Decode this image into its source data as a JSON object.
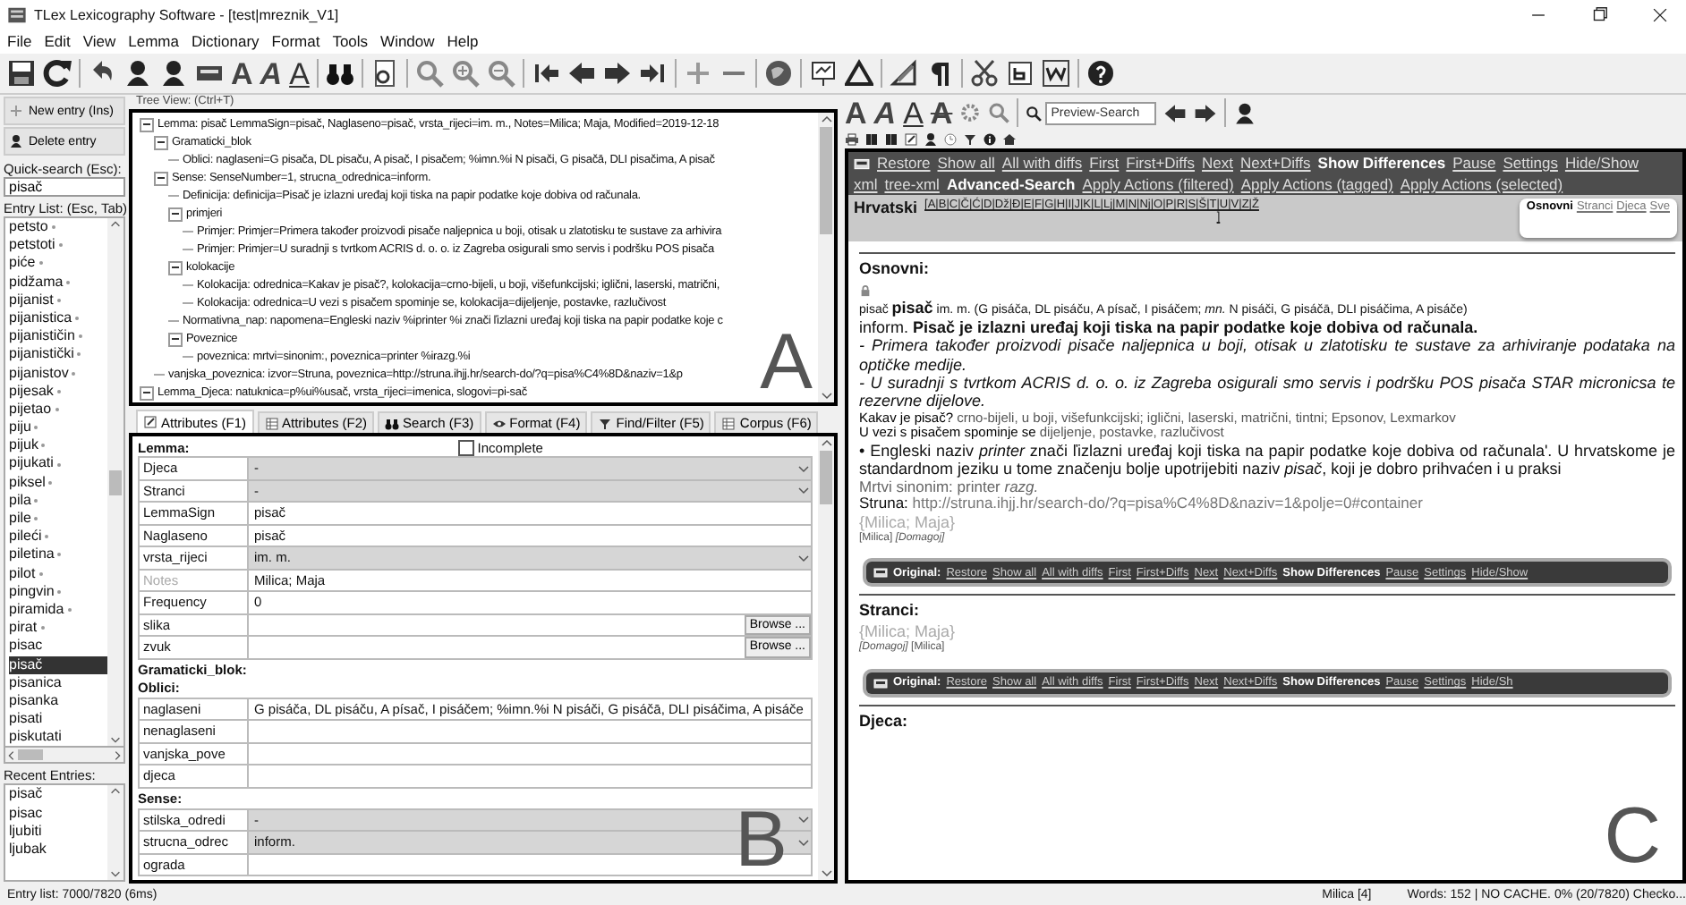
{
  "window": {
    "title": "TLex Lexicography Software - [test|mreznik_V1]"
  },
  "menu": [
    "File",
    "Edit",
    "View",
    "Lemma",
    "Dictionary",
    "Format",
    "Tools",
    "Window",
    "Help"
  ],
  "toolbar": {
    "font_styles": [
      {
        "label": "A"
      },
      {
        "label": "A"
      },
      {
        "label": "A"
      }
    ]
  },
  "sidebar": {
    "buttons": [
      "New entry (Ins)",
      "Delete entry"
    ],
    "quick_search_label": "Quick-search (Esc):",
    "quick_search_value": "pisač",
    "entry_list_label": "Entry List: (Esc, Tab)",
    "entries": [
      {
        "text": "petsto",
        "marked": true,
        "selected": false
      },
      {
        "text": "petstoti",
        "marked": true,
        "selected": false
      },
      {
        "text": "piće",
        "marked": true,
        "selected": false
      },
      {
        "text": "pidžama",
        "marked": true,
        "selected": false
      },
      {
        "text": "pijanist",
        "marked": true,
        "selected": false
      },
      {
        "text": "pijanistica",
        "marked": true,
        "selected": false
      },
      {
        "text": "pijanističin",
        "marked": true,
        "selected": false
      },
      {
        "text": "pijanistički",
        "marked": true,
        "selected": false
      },
      {
        "text": "pijanistov",
        "marked": true,
        "selected": false
      },
      {
        "text": "pijesak",
        "marked": true,
        "selected": false
      },
      {
        "text": "pijetao",
        "marked": true,
        "selected": false
      },
      {
        "text": "piju",
        "marked": true,
        "selected": false
      },
      {
        "text": "pijuk",
        "marked": true,
        "selected": false
      },
      {
        "text": "pijukati",
        "marked": true,
        "selected": false
      },
      {
        "text": "piksel",
        "marked": true,
        "selected": false
      },
      {
        "text": "pila",
        "marked": true,
        "selected": false
      },
      {
        "text": "pile",
        "marked": true,
        "selected": false
      },
      {
        "text": "pileći",
        "marked": true,
        "selected": false
      },
      {
        "text": "piletina",
        "marked": true,
        "selected": false
      },
      {
        "text": "pilot",
        "marked": true,
        "selected": false
      },
      {
        "text": "pingvin",
        "marked": true,
        "selected": false
      },
      {
        "text": "piramida",
        "marked": true,
        "selected": false
      },
      {
        "text": "pirat",
        "marked": true,
        "selected": false
      },
      {
        "text": "pisac",
        "marked": false,
        "selected": false
      },
      {
        "text": "pisač",
        "marked": false,
        "selected": true
      },
      {
        "text": "pisanica",
        "marked": false,
        "selected": false
      },
      {
        "text": "pisanka",
        "marked": false,
        "selected": false
      },
      {
        "text": "pisati",
        "marked": false,
        "selected": false
      },
      {
        "text": "piskutati",
        "marked": false,
        "selected": false
      }
    ],
    "recent_label": "Recent Entries:",
    "recent": [
      "pisač",
      "pisac",
      "ljubiti",
      "ljubak"
    ]
  },
  "tree": {
    "title": "Tree View: (Ctrl+T)",
    "nodes": [
      {
        "text": "Lemma: pisač  LemmaSign=pisač, Naglaseno=pisač, vrsta_rijeci=im. m., Notes=Milica; Maja, Modified=2019-12-18",
        "expanded": true,
        "children": [
          {
            "text": "Gramaticki_blok",
            "expanded": true,
            "children": [
              {
                "text": "Oblici:  naglaseni=G pisača, DL pisaču, A pisač, I pisačem; %imn.%i N pisači, G pisačā, DLI pisačima, A pisač"
              }
            ]
          },
          {
            "text": "Sense:  SenseNumber=1, strucna_odrednica=inform.",
            "expanded": true,
            "children": [
              {
                "text": "Definicija:  definicija=Pisač je izlazni uređaj koji tiska na papir podatke koje dobiva od računala."
              },
              {
                "text": "primjeri",
                "expanded": true,
                "children": [
                  {
                    "text": "Primjer:  Primjer=Primera također proizvodi pisače naljepnica u boji, otisak u zlatotisku te sustave za arhivira"
                  },
                  {
                    "text": "Primjer:  Primjer=U suradnji s tvrtkom ACRIS d. o. o. iz Zagreba osigurali smo servis i podršku POS pisača"
                  }
                ]
              },
              {
                "text": "kolokacije",
                "expanded": true,
                "children": [
                  {
                    "text": "Kolokacija:  odrednica=Kakav je pisač?, kolokacija=crno-bijeli, u boji, višefunkcijski; iglični, laserski, matrični,"
                  },
                  {
                    "text": "Kolokacija:  odrednica=U vezi s pisačem spominje se, kolokacija=dijeljenje, postavke, razlučivost"
                  }
                ]
              },
              {
                "text": "Normativna_nap:  napomena=Engleski naziv %iprinter %i znači ľizlazni uređaj koji tiska na papir podatke koje c"
              },
              {
                "text": "Poveznice",
                "expanded": true,
                "children": [
                  {
                    "text": "poveznica:  mrtvi=sinonim:, poveznica=printer %irazg.%i"
                  }
                ]
              }
            ]
          },
          {
            "text": "vanjska_poveznica:  izvor=Struna, poveznica=http://struna.ihjj.hr/search-do/?q=pisa%C4%8D&naziv=1&p"
          }
        ]
      },
      {
        "text": "Lemma_Djeca:  natuknica=p%ui%usač, vrsta_rijeci=imenica, slogovi=pi-sač",
        "expanded": true
      }
    ]
  },
  "tabs": [
    {
      "label": "Attributes (F1)",
      "selected": true
    },
    {
      "label": "Attributes (F2)",
      "selected": false
    },
    {
      "label": "Search (F3)",
      "selected": false
    },
    {
      "label": "Format (F4)",
      "selected": false
    },
    {
      "label": "Find/Filter (F5)",
      "selected": false
    },
    {
      "label": "Corpus (F6)",
      "selected": false
    }
  ],
  "form": {
    "sections": [
      {
        "heading": "Lemma:",
        "checkbox": {
          "label": "Incomplete",
          "checked": false
        },
        "rows": [
          {
            "label": "Djeca",
            "kind": "dropdown",
            "value": "-",
            "disabled": false
          },
          {
            "label": "Stranci",
            "kind": "dropdown",
            "value": "-",
            "disabled": false
          },
          {
            "label": "LemmaSign",
            "kind": "text",
            "value": "pisač",
            "disabled": false
          },
          {
            "label": "Naglaseno",
            "kind": "text",
            "value": "pisač",
            "disabled": false
          },
          {
            "label": "vrsta_rijeci",
            "kind": "dropdown",
            "value": "im. m.",
            "disabled": false
          },
          {
            "label": "Notes",
            "kind": "text",
            "value": "Milica; Maja",
            "disabled": true
          },
          {
            "label": "Frequency",
            "kind": "text",
            "value": "0",
            "disabled": false
          },
          {
            "label": "slika",
            "kind": "browse",
            "button": "Browse ...",
            "disabled": false
          },
          {
            "label": "zvuk",
            "kind": "browse",
            "button": "Browse ...",
            "disabled": false
          }
        ]
      },
      {
        "heading": "Gramaticki_blok:"
      },
      {
        "heading": "Oblici:",
        "rows": [
          {
            "label": "naglaseni",
            "kind": "text",
            "value": "G pisáča, DL pisáču, A písač, I pisáčem; %imn.%i N pisáči, G pisáčā, DLI pisáčima, A pisáče",
            "disabled": false
          },
          {
            "label": "nenaglaseni",
            "kind": "text",
            "disabled": false
          },
          {
            "label": "vanjska_pove",
            "kind": "text",
            "disabled": false
          },
          {
            "label": "djeca",
            "kind": "text",
            "disabled": false
          }
        ]
      },
      {
        "heading": "Sense:",
        "rows": [
          {
            "label": "stilska_odredi",
            "kind": "dropdown",
            "value": "-",
            "disabled": false
          },
          {
            "label": "strucna_odrec",
            "kind": "dropdown",
            "value": "inform.",
            "disabled": false
          },
          {
            "label": "ograda",
            "kind": "text",
            "disabled": false
          }
        ]
      }
    ]
  },
  "preview_toolbar": {
    "font_styles": [
      {
        "label": "A"
      },
      {
        "label": "A"
      },
      {
        "label": "A"
      },
      {
        "label": "A"
      }
    ],
    "search_placeholder": "Preview-Search"
  },
  "preview": {
    "action_links": [
      {
        "text": "Restore",
        "strong": false
      },
      {
        "text": "Show all",
        "strong": false
      },
      {
        "text": "All with diffs",
        "strong": false
      },
      {
        "text": "First",
        "strong": false
      },
      {
        "text": "First+Diffs",
        "strong": false
      },
      {
        "text": "Next",
        "strong": false
      },
      {
        "text": "Next+Diffs",
        "strong": false
      },
      {
        "text": "Show Differences",
        "strong": true
      },
      {
        "text": "Pause",
        "strong": false
      },
      {
        "text": "Settings",
        "strong": false
      },
      {
        "text": "Hide/Show",
        "strong": false
      }
    ],
    "view_links": [
      {
        "text": "xml",
        "strong": false
      },
      {
        "text": "tree-xml",
        "strong": false
      },
      {
        "text": "Advanced-Search",
        "strong": true
      },
      {
        "text": "Apply Actions (filtered)",
        "strong": false
      },
      {
        "text": "Apply Actions (tagged)",
        "strong": false
      },
      {
        "text": "Apply Actions (selected)",
        "strong": false
      }
    ],
    "language": "Hrvatski",
    "alphabet": "[A|B|C|Č|Ć|D|Dž|Đ|E|F|G|H|I|J|K|L|Lj|M|N|Nj|O|P|R|S|Š|T|U|V|Z|Ž",
    "alphabet_end": "]",
    "view_tabs": [
      {
        "label": "Osnovni",
        "selected": true
      },
      {
        "label": "Stranci",
        "selected": false
      },
      {
        "label": "Djeca",
        "selected": false
      },
      {
        "label": "Sve",
        "selected": false
      }
    ],
    "sections": [
      {
        "heading": "Osnovni:",
        "lines": [
          {
            "kind": "headword",
            "text": "pisač **pisač** im. m. (G pisáča, DL pisáču, A písač, I pisáčem; *mn.* N pisáči, G pisáčā, DLI pisáčima, A pisáče)"
          },
          {
            "kind": "definition",
            "text": "inform. **Pisač je izlazni uređaj koji tiska na papir podatke koje dobiva od računala.**"
          },
          {
            "kind": "example",
            "text": "- Primera također proizvodi pisače naljepnica u boji, otisak u zlatotisku te sustave za arhiviranje podataka na optičke medije."
          },
          {
            "kind": "example",
            "text": "- U suradnji s tvrtkom ACRIS d. o. o. iz Zagreba osigurali smo servis i podršku POS pisača STAR micronicsa te rezervne dijelove."
          },
          {
            "kind": "collocation",
            "head": "Kakav je pisač?",
            "text": "crno-bijeli, u boji, višefunkcijski; iglični, laserski, matrični,  tintni; Epsonov, Lexmarkov"
          },
          {
            "kind": "collocation",
            "head": "U vezi s pisačem spominje se",
            "text": "dijeljenje, postavke, razlučivost"
          },
          {
            "kind": "note",
            "text": "• Engleski naziv *printer* znači ľizlazni uređaj koji tiska na papir podatke koje dobiva od računala'. U hrvatskome je standardnom jeziku u tome značenju bolje upotrijebiti naziv *pisač*, koji je dobro prihvaćen i u praksi"
          },
          {
            "kind": "synonym",
            "text": "Mrtvi sinonim: printer *razg.*"
          },
          {
            "kind": "source",
            "head": "Struna:",
            "text": "http://struna.ihjj.hr/search-do/?q=pisa%C4%8D&naziv=1&polje=0#container"
          },
          {
            "kind": "authors",
            "text": "{Milica; Maja}"
          },
          {
            "kind": "editors",
            "text": "[Milica] *[Domagoj]*"
          }
        ],
        "original_bar": {
          "label": "Original:",
          "links": [
            {
              "text": "Restore",
              "strong": false
            },
            {
              "text": "Show all",
              "strong": false
            },
            {
              "text": "All with diffs",
              "strong": false
            },
            {
              "text": "First",
              "strong": false
            },
            {
              "text": "First+Diffs",
              "strong": false
            },
            {
              "text": "Next",
              "strong": false
            },
            {
              "text": "Next+Diffs",
              "strong": false
            },
            {
              "text": "Show Differences",
              "strong": true
            },
            {
              "text": "Pause",
              "strong": false
            },
            {
              "text": "Settings",
              "strong": false
            },
            {
              "text": "Hide/Show",
              "strong": false
            }
          ]
        }
      },
      {
        "heading": "Stranci:",
        "lines": [
          {
            "kind": "authors",
            "text": "{Milica; Maja}"
          },
          {
            "kind": "editors",
            "text": "*[Domagoj]* [Milica]"
          }
        ],
        "original_bar": {
          "label": "Original:",
          "links": [
            {
              "text": "Restore",
              "strong": false
            },
            {
              "text": "Show all",
              "strong": false
            },
            {
              "text": "All with diffs",
              "strong": false
            },
            {
              "text": "First",
              "strong": false
            },
            {
              "text": "First+Diffs",
              "strong": false
            },
            {
              "text": "Next",
              "strong": false
            },
            {
              "text": "Next+Diffs",
              "strong": false
            },
            {
              "text": "Show Differences",
              "strong": true
            },
            {
              "text": "Pause",
              "strong": false
            },
            {
              "text": "Settings",
              "strong": false
            },
            {
              "text": "Hide/Sh",
              "strong": false
            }
          ]
        }
      },
      {
        "heading": "Djeca:"
      }
    ]
  },
  "annotations": [
    "A",
    "B",
    "C"
  ],
  "status_bar": {
    "left": "Entry list: 7000/7820 (6ms)",
    "user": "Milica [4]",
    "info": "Words: 152 | NO CACHE. 0% (20/7820) Checko..."
  }
}
